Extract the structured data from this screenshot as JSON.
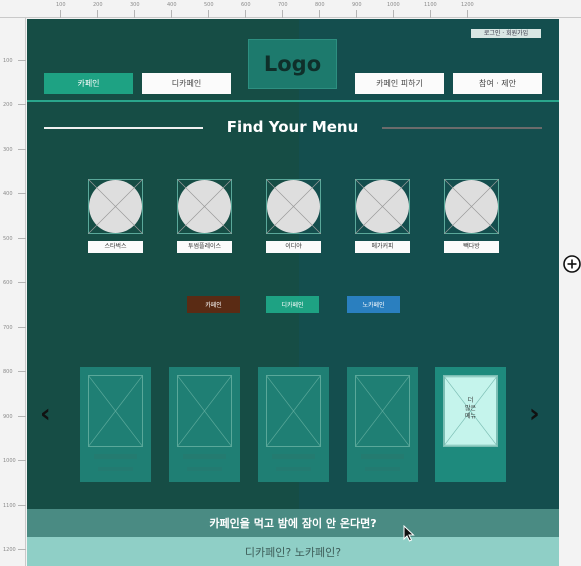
{
  "ruler": {
    "top": [
      "100",
      "200",
      "300",
      "400",
      "500",
      "600",
      "700",
      "800",
      "900",
      "1000",
      "1100",
      "1200"
    ],
    "left": [
      "100",
      "200",
      "300",
      "400",
      "500",
      "600",
      "700",
      "800",
      "900",
      "1000",
      "1100",
      "1200"
    ]
  },
  "header": {
    "top_link": "로그인 · 회원가입",
    "logo": "Logo",
    "nav": [
      "카페인",
      "디카페인",
      "카페인 피하기",
      "참여 · 제안"
    ]
  },
  "section": {
    "title": "Find Your Menu"
  },
  "brands": [
    "스타벅스",
    "투썸플레이스",
    "이디야",
    "메가커피",
    "빽다방"
  ],
  "filters": [
    "카페인",
    "디카페인",
    "노카페인"
  ],
  "filter_colors": [
    "#5a2b14",
    "#1ea283",
    "#2a7fbf"
  ],
  "cards": {
    "active_text": "더\n많은\n메뉴"
  },
  "carousel": {
    "prev": "‹",
    "next": "›"
  },
  "banners": {
    "caffeine": "카페인을 먹고 밤에 잠이 안 온다면?",
    "decaf": "디카페인? 노카페인?"
  },
  "icons": [
    "zoom-in-icon",
    "cursor-icon",
    "placeholder-image-icon"
  ]
}
